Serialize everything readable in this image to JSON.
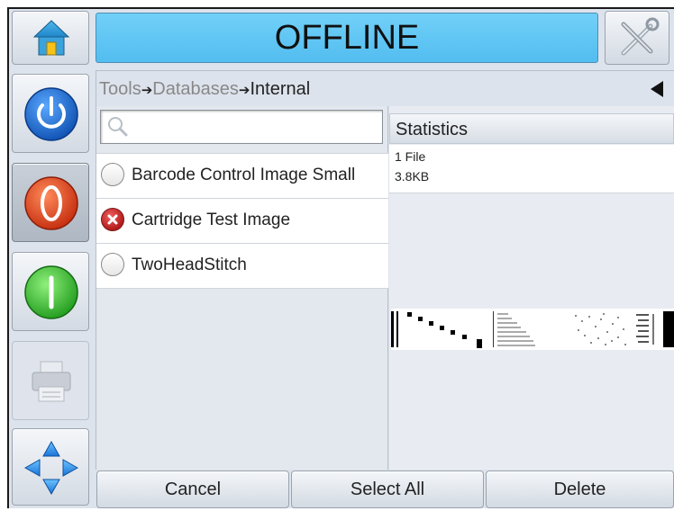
{
  "header": {
    "status": "OFFLINE"
  },
  "icons": {
    "home": "home-icon",
    "tools": "tools-icon",
    "power": "power-icon",
    "stop": "stop-icon",
    "start": "start-icon",
    "printer": "printer-icon",
    "navigation": "navigation-icon",
    "search": "search-icon",
    "collapse": "collapse-arrow-icon"
  },
  "breadcrumb": {
    "part1": "Tools",
    "part2": "Databases",
    "current": "Internal",
    "separator": "➔"
  },
  "search": {
    "placeholder": "",
    "value": ""
  },
  "list": {
    "items": [
      {
        "label": "Barcode Control Image Small",
        "state": "normal"
      },
      {
        "label": "Cartridge Test Image",
        "state": "error"
      },
      {
        "label": "TwoHeadStitch",
        "state": "normal"
      }
    ]
  },
  "stats": {
    "header": "Statistics",
    "files": "1 File",
    "size": "3.8KB"
  },
  "toolbar": {
    "cancel": "Cancel",
    "select_all": "Select All",
    "delete": "Delete"
  },
  "colors": {
    "status_bg": "#5ec4f4",
    "panel_bg": "#dde3ec",
    "power_blue": "#1e6fd0",
    "stop_red": "#e34a1c",
    "start_green": "#3ab534"
  }
}
